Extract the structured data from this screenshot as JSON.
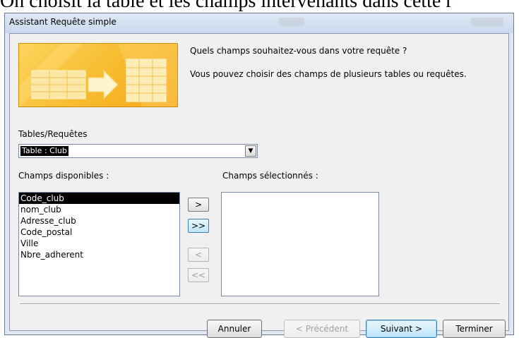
{
  "caption_text": "On choisit la table et les champs intervenants dans cette r",
  "window": {
    "title": "Assistant Requête simple"
  },
  "wizard": {
    "prompt_question": "Quels champs souhaitez-vous dans votre requête ?",
    "prompt_info": "Vous pouvez choisir des champs de plusieurs tables ou requêtes.",
    "tables_label": "Tables/Requêtes",
    "tables_selected": "Table : Club",
    "available_label": "Champs disponibles :",
    "selected_label": "Champs sélectionnés :",
    "available_fields": [
      "Code_club",
      "nom_club",
      "Adresse_club",
      "Code_postal",
      "Ville",
      "Nbre_adherent"
    ],
    "selected_fields": [],
    "move_buttons": {
      "add_one": ">",
      "add_all": ">>",
      "remove_one": "<",
      "remove_all": "<<"
    }
  },
  "footer": {
    "cancel": "Annuler",
    "previous": "< Précédent",
    "next": "Suivant >",
    "finish": "Terminer"
  },
  "colors": {
    "banner": "#f7b82a",
    "dialog_bg": "#f0f0f0",
    "frame": "#dfe8f3"
  },
  "icons": {
    "banner": "table-to-query-arrow-icon",
    "combo_arrow": "chevron-down-icon"
  }
}
